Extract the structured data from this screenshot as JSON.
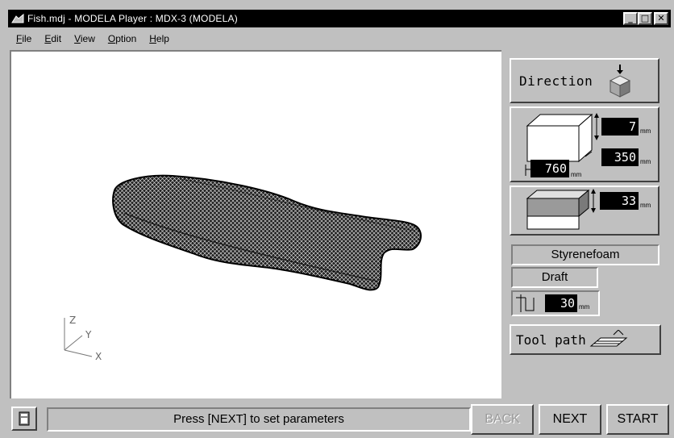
{
  "window": {
    "title": "Fish.mdj - MODELA Player  : MDX-3 (MODELA)",
    "controls": {
      "minimize": "_",
      "maximize": "□",
      "close": "✕"
    }
  },
  "menu": [
    "File",
    "Edit",
    "View",
    "Option",
    "Help"
  ],
  "viewport": {
    "axes": {
      "z": "Z",
      "y": "Y",
      "x": "X"
    }
  },
  "panel": {
    "direction_label": "Direction",
    "workpiece": {
      "height": "7",
      "depth": "350",
      "width": "760",
      "unit": "mm"
    },
    "material_depth": {
      "value": "33",
      "unit": "mm"
    },
    "material_name": "Styrenefoam",
    "quality": "Draft",
    "cut_depth": {
      "value": "30",
      "unit": "mm"
    },
    "toolpath_label": "Tool path"
  },
  "bottom": {
    "status": "Press [NEXT] to set parameters",
    "back_label": "BACK",
    "next_label": "NEXT",
    "start_label": "START"
  }
}
